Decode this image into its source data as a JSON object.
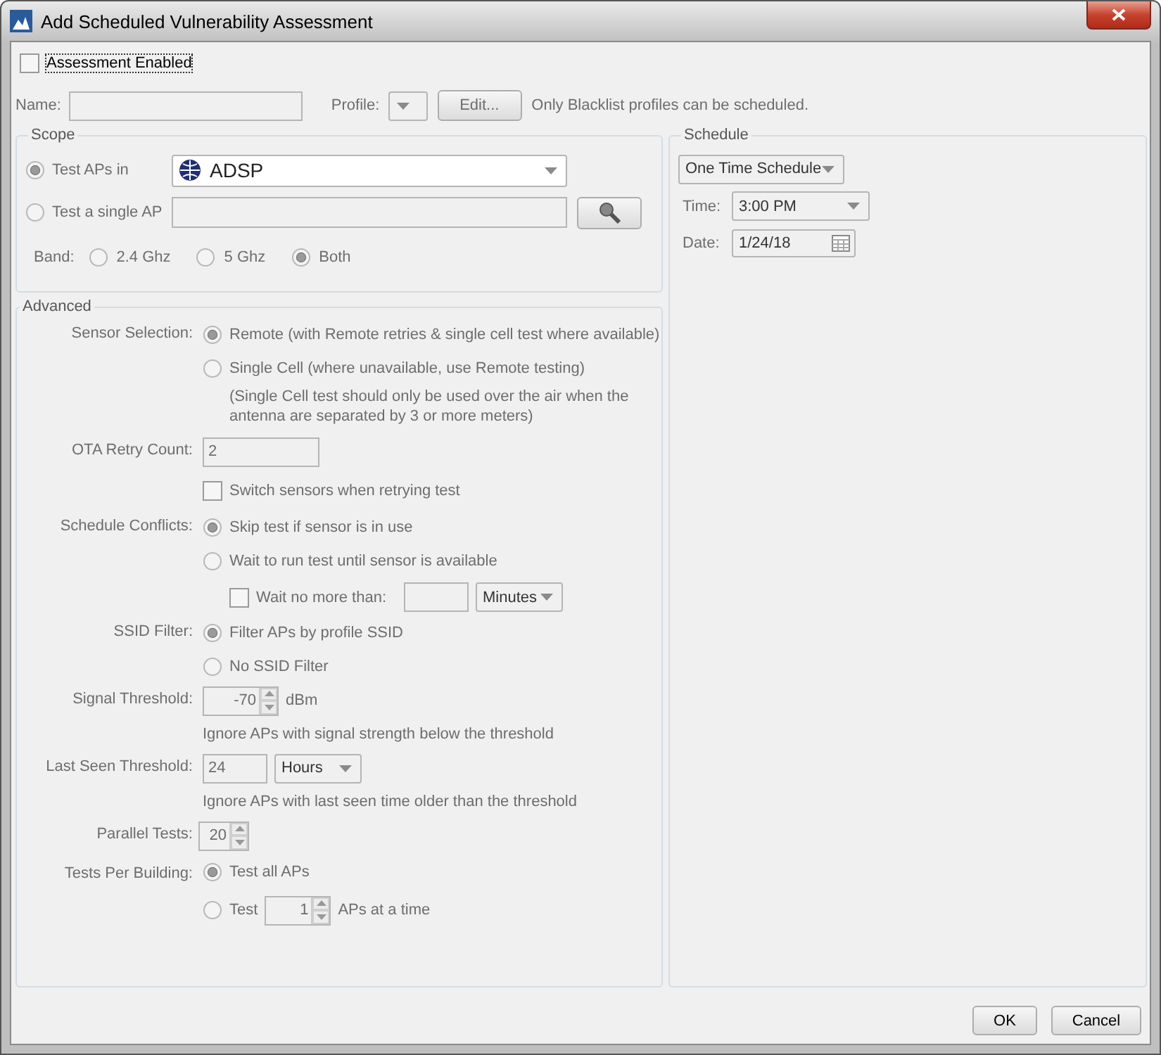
{
  "window": {
    "title": "Add Scheduled Vulnerability Assessment"
  },
  "assessment_enabled": {
    "label": "Assessment Enabled",
    "checked": false
  },
  "name": {
    "label": "Name:"
  },
  "profile": {
    "label": "Profile:",
    "edit_button": "Edit...",
    "note": "Only Blacklist profiles can be scheduled."
  },
  "scope": {
    "title": "Scope",
    "options": [
      {
        "label": "Test APs in",
        "selected": true,
        "value": "ADSP"
      },
      {
        "label": "Test a single AP",
        "selected": false
      }
    ],
    "band": {
      "label": "Band:",
      "options": [
        {
          "label": "2.4 Ghz",
          "selected": false
        },
        {
          "label": "5 Ghz",
          "selected": false
        },
        {
          "label": "Both",
          "selected": true
        }
      ]
    }
  },
  "advanced": {
    "title": "Advanced",
    "sensor_selection": {
      "label": "Sensor Selection:",
      "options": [
        {
          "label": "Remote (with Remote retries & single cell test where available)",
          "selected": true
        },
        {
          "label": "Single Cell (where unavailable, use Remote testing)",
          "selected": false,
          "note": "(Single Cell test should only be used over the air when the antenna are separated by 3 or more meters)"
        }
      ]
    },
    "ota_retry_count": {
      "label": "OTA Retry Count:",
      "value": "2"
    },
    "switch_sensors": {
      "label": "Switch sensors when retrying test",
      "checked": false
    },
    "schedule_conflicts": {
      "label": "Schedule Conflicts:",
      "options": [
        {
          "label": "Skip test if sensor is in use",
          "selected": true
        },
        {
          "label": "Wait to run test until sensor is available",
          "selected": false
        }
      ],
      "wait_no_more_than": {
        "label": "Wait no more than:",
        "checked": false,
        "unit": "Minutes"
      }
    },
    "ssid_filter": {
      "label": "SSID Filter:",
      "options": [
        {
          "label": "Filter APs by profile SSID",
          "selected": true
        },
        {
          "label": "No SSID Filter",
          "selected": false
        }
      ]
    },
    "signal_threshold": {
      "label": "Signal Threshold:",
      "value": "-70",
      "unit": "dBm",
      "note": "Ignore APs with signal strength below the threshold"
    },
    "last_seen_threshold": {
      "label": "Last Seen Threshold:",
      "value": "24",
      "unit": "Hours",
      "note": "Ignore APs with last seen time older than the threshold"
    },
    "parallel_tests": {
      "label": "Parallel Tests:",
      "value": "20"
    },
    "tests_per_building": {
      "label": "Tests Per Building:",
      "options": [
        {
          "label": "Test all APs",
          "selected": true
        },
        {
          "label": "Test",
          "selected": false,
          "value": "1",
          "suffix": "APs at a time"
        }
      ]
    }
  },
  "schedule": {
    "title": "Schedule",
    "type": "One Time Schedule",
    "time": {
      "label": "Time:",
      "value": "3:00 PM"
    },
    "date": {
      "label": "Date:",
      "value": "1/24/18"
    }
  },
  "buttons": [
    {
      "label": "OK"
    },
    {
      "label": "Cancel"
    }
  ]
}
